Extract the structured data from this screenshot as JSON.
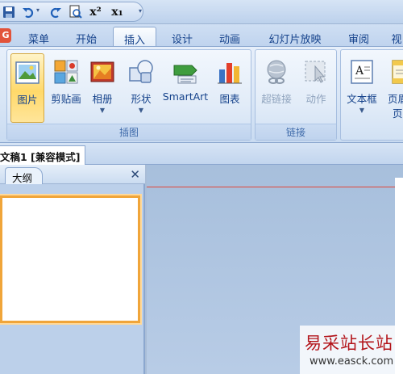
{
  "quick_access": {
    "icons": [
      "save-icon",
      "undo-icon",
      "redo-icon",
      "print-preview-icon",
      "superscript-icon",
      "subscript-icon",
      "customize-icon"
    ],
    "superscript": "x²",
    "subscript": "x₁"
  },
  "tabs": [
    {
      "label": "菜单"
    },
    {
      "label": "开始"
    },
    {
      "label": "插入",
      "active": true
    },
    {
      "label": "设计"
    },
    {
      "label": "动画"
    },
    {
      "label": "幻灯片放映"
    },
    {
      "label": "审阅"
    },
    {
      "label": "视"
    }
  ],
  "ribbon": {
    "groups": {
      "illustrations": {
        "label": "插图",
        "buttons": [
          {
            "label": "图片",
            "icon": "picture-icon",
            "selected": true
          },
          {
            "label": "剪贴画",
            "icon": "clip-art-icon"
          },
          {
            "label": "相册",
            "icon": "photo-album-icon",
            "dropdown": true
          },
          {
            "label": "形状",
            "icon": "shapes-icon",
            "dropdown": true
          },
          {
            "label": "SmartArt",
            "icon": "smartart-icon"
          },
          {
            "label": "图表",
            "icon": "chart-icon"
          }
        ]
      },
      "links": {
        "label": "链接",
        "buttons": [
          {
            "label": "超链接",
            "icon": "hyperlink-icon",
            "disabled": true
          },
          {
            "label": "动作",
            "icon": "action-icon",
            "disabled": true
          }
        ]
      },
      "text": {
        "buttons": [
          {
            "label": "文本框",
            "icon": "text-box-icon",
            "dropdown": true
          },
          {
            "label": "页眉",
            "sublabel": "页",
            "icon": "header-footer-icon"
          }
        ]
      }
    }
  },
  "document": {
    "tab_title": "文稿1 [兼容模式]"
  },
  "left_pane": {
    "tab_label": "大纲",
    "close_glyph": "✕"
  },
  "watermark": {
    "text_cn": "易采站长站",
    "url": "www.easck.com"
  }
}
